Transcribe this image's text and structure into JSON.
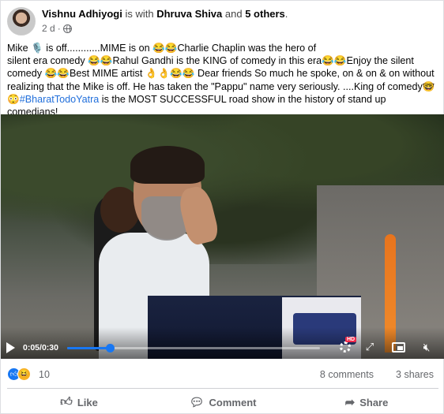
{
  "post": {
    "author": "Vishnu Adhiyogi",
    "with_text": " is with ",
    "tagged": "Dhruva Shiva",
    "and_text": " and ",
    "others": "5 others",
    "period": ".",
    "time": "2 d",
    "dot": "·",
    "privacy_icon": "globe-icon",
    "body": {
      "line1": "Mike 🎙️ is off............MIME is on 😂😂Charlie Chaplin was the hero of",
      "line2": "silent era comedy 😂😂Rahul Gandhi is the KING of comedy in this era😂😂Enjoy the silent",
      "line3": "comedy 😂😂Best MIME artist 👌👌😂😂 Dear friends So much he spoke, on & on & on without",
      "line4": "realizing that the Mike is off. He has taken the \"Pappu\" name very seriously. ....King of comedy🤓",
      "line5_emoji": "😳",
      "hashtag": "#BharatTodoYatra",
      "line5_rest": " is the MOST SUCCESSFUL road show in the history of stand up comedians!"
    }
  },
  "video": {
    "current": "0:05",
    "separator": " / ",
    "duration": "0:30",
    "progress_fraction": 0.17,
    "hd_badge": "HD",
    "accent": "#1877f2"
  },
  "reactions": {
    "count": "10",
    "comments": "8 comments",
    "shares": "3 shares"
  },
  "actions": {
    "like": "Like",
    "comment": "Comment",
    "share": "Share"
  }
}
